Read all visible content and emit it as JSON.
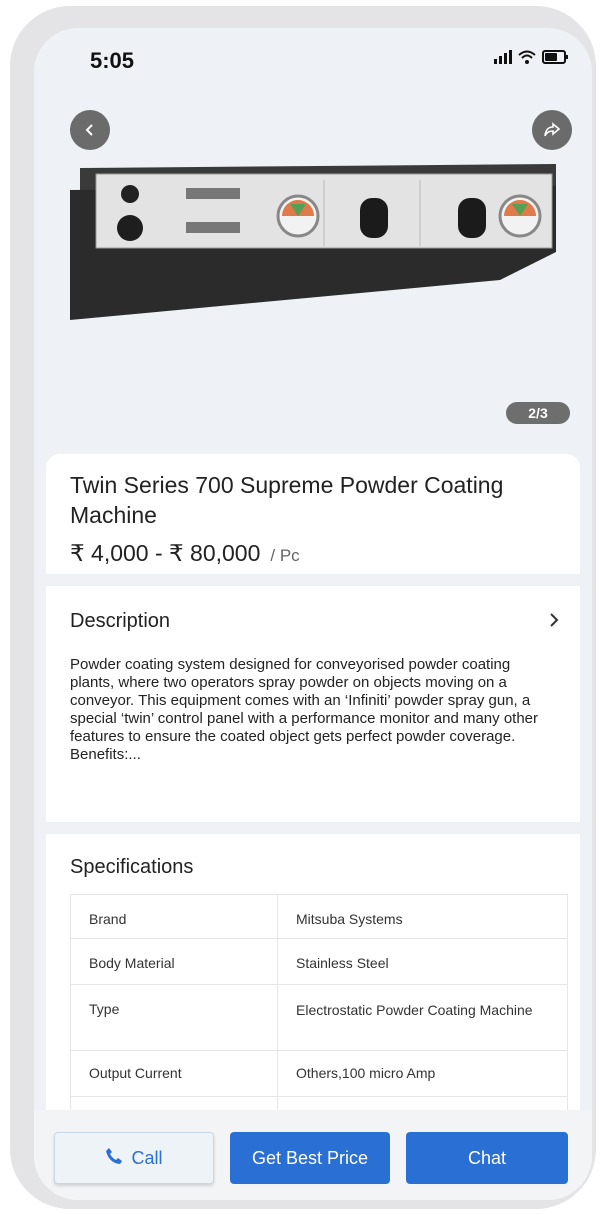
{
  "status": {
    "time": "5:05"
  },
  "hero": {
    "page_indicator": "2/3"
  },
  "product": {
    "title": "Twin Series 700 Supreme Powder Coating Machine",
    "price": "₹ 4,000 - ₹ 80,000",
    "unit": "/ Pc"
  },
  "description": {
    "heading": "Description",
    "text": "Powder coating system designed for conveyorised powder coating plants, where two operators spray powder on objects moving on a conveyor. This equipment comes with an ‘Infiniti’ powder spray gun, a special ‘twin’ control panel with a performance monitor and many other features to ensure the coated object gets perfect powder coverage.",
    "more": "Benefits:..."
  },
  "specifications": {
    "heading": "Specifications",
    "rows": [
      {
        "label": "Brand",
        "value": "Mitsuba Systems"
      },
      {
        "label": "Body Material",
        "value": "Stainless Steel"
      },
      {
        "label": "Type",
        "value": "Electrostatic Powder Coating Machine"
      },
      {
        "label": "Output Current",
        "value": "Others,100 micro Amp"
      }
    ]
  },
  "actions": {
    "call": "Call",
    "best_price": "Get Best Price",
    "chat": "Chat"
  },
  "icons": {
    "back": "back-arrow-icon",
    "share": "share-icon",
    "phone": "phone-icon",
    "chevron": "chevron-right-icon"
  },
  "colors": {
    "primary": "#2a6fd3",
    "badge": "#6e6e6e"
  }
}
